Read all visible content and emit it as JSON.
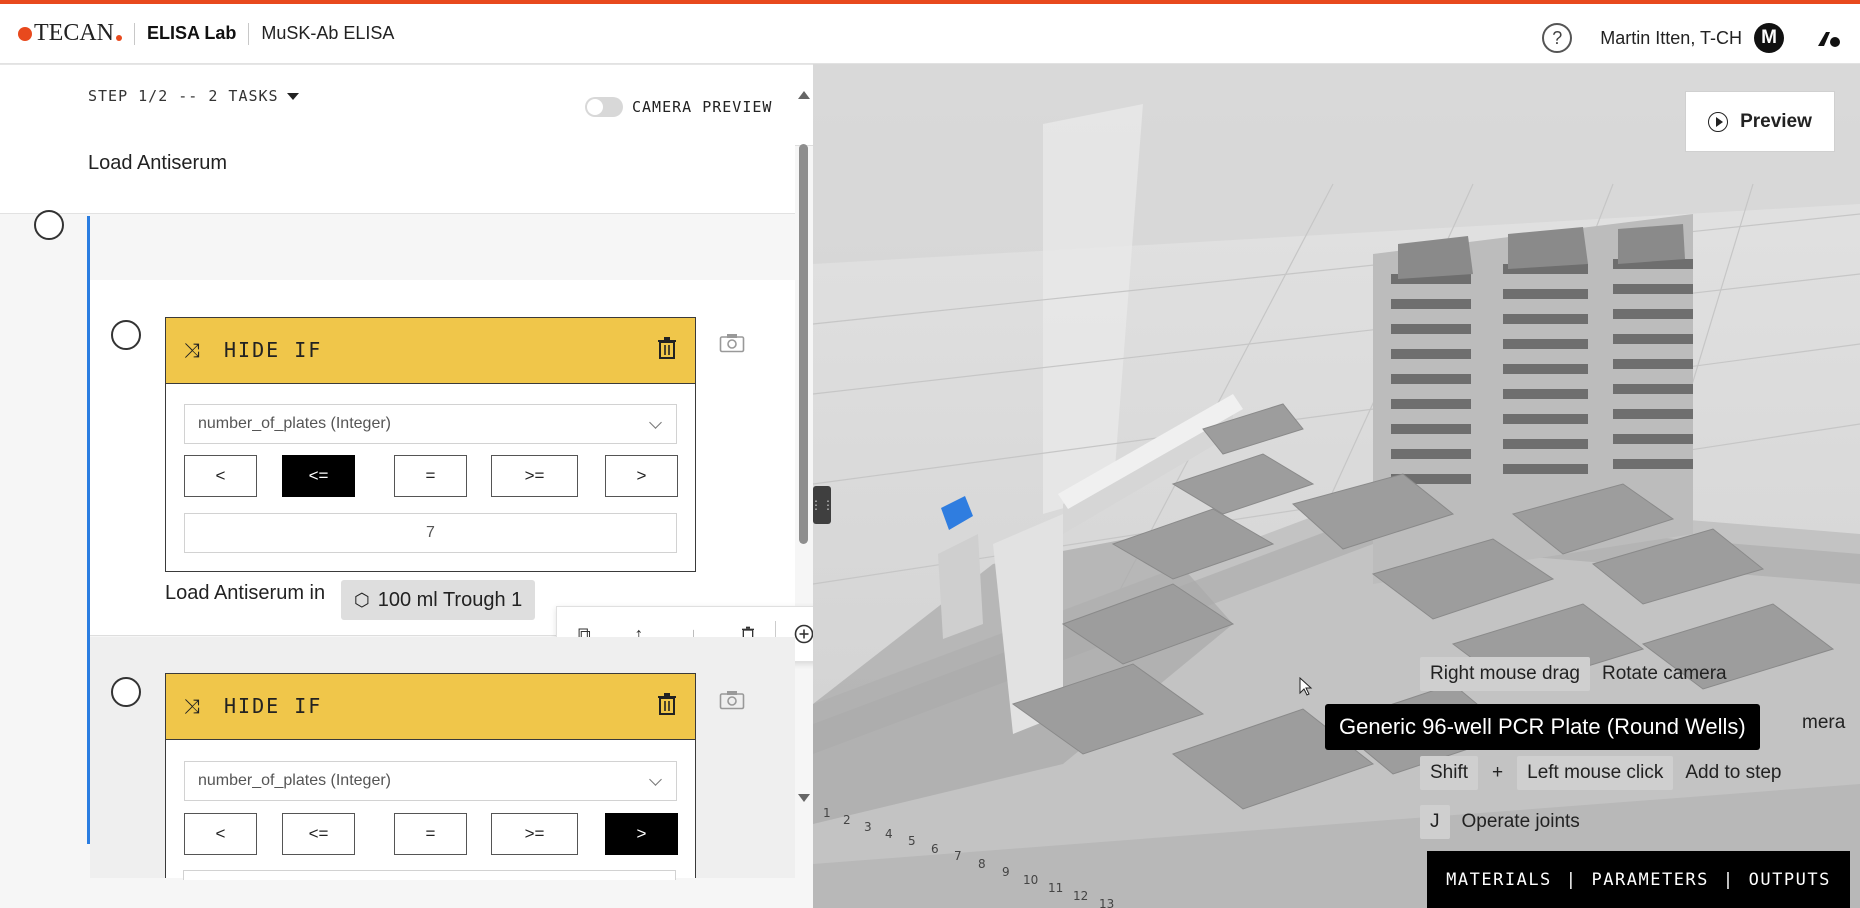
{
  "header": {
    "logo_text": "TECAN",
    "app_name": "ELISA Lab",
    "protocol_name": "MuSK-Ab ELISA",
    "help_label": "?",
    "user_name": "Martin Itten, T-CH",
    "avatar_initial": "M",
    "accent_color": "#e8491d"
  },
  "camera_preview": {
    "label": "CAMERA PREVIEW",
    "enabled": false
  },
  "step": {
    "header": "STEP 1/2 -- 2 TASKS",
    "task_title": "Load Antiserum",
    "conditions": [
      {
        "title": "HIDE IF",
        "parameter": "number_of_plates (Integer)",
        "operators": [
          "<",
          "<=",
          "=",
          ">=",
          ">"
        ],
        "selected_operator": "<=",
        "value": "7"
      },
      {
        "title": "HIDE IF",
        "parameter": "number_of_plates (Integer)",
        "operators": [
          "<",
          "<=",
          "=",
          ">=",
          ">"
        ],
        "selected_operator": ">"
      }
    ],
    "load_prefix": "Load Antiserum in",
    "load_target": "100 ml Trough 1"
  },
  "scene": {
    "preview_label": "Preview",
    "tooltip": "Generic 96-well PCR Plate (Round Wells)",
    "hints": [
      {
        "key": "Right mouse drag",
        "desc": "Rotate camera"
      },
      {
        "key": "Shift",
        "plus": "+",
        "key2": "Left mouse click",
        "desc": "Add to step"
      },
      {
        "key": "J",
        "desc": "Operate joints"
      }
    ],
    "partial_hint_tail": "mera",
    "rail_numbers": [
      "1",
      "2",
      "3",
      "4",
      "5",
      "6",
      "7",
      "8",
      "9",
      "10",
      "11",
      "12",
      "13"
    ]
  },
  "bottom_tabs": {
    "materials": "MATERIALS",
    "parameters": "PARAMETERS",
    "outputs": "OUTPUTS",
    "separator": "|"
  },
  "colors": {
    "condition_header": "#f0c64a",
    "selection_rail": "#2a7de1",
    "selected_highlight": "#2f7de0"
  }
}
